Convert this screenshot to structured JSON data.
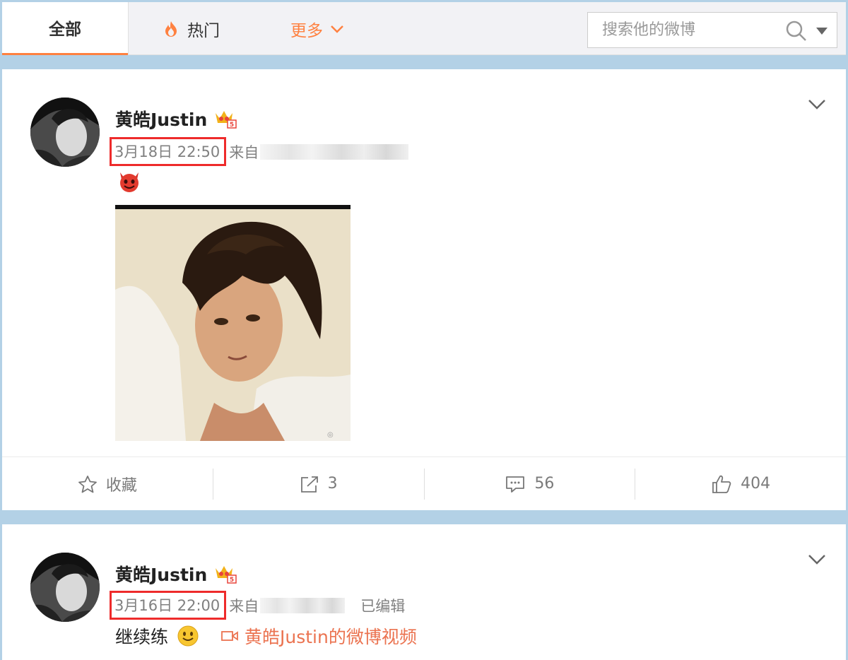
{
  "tabs": {
    "all": "全部",
    "hot": "热门",
    "more": "更多"
  },
  "search": {
    "placeholder": "搜索他的微博"
  },
  "posts": [
    {
      "username": "黄皓Justin",
      "time": "3月18日 22:50",
      "source_prefix": "来自",
      "actions": {
        "favorite": "收藏",
        "repost": "3",
        "comment": "56",
        "like": "404"
      }
    },
    {
      "username": "黄皓Justin",
      "time": "3月16日 22:00",
      "source_prefix": "来自",
      "edited": "已编辑",
      "text": "继续练",
      "video_link": "黄皓Justin的微博视频"
    }
  ],
  "colors": {
    "accent": "#ff8140",
    "highlight_box": "#ee2b2b",
    "link": "#eb7350"
  },
  "icons": [
    "fire-icon",
    "chevron-down-icon",
    "search-icon",
    "caret-down-icon",
    "crown-icon",
    "devil-emoji-icon",
    "star-icon",
    "share-icon",
    "comment-icon",
    "thumbs-up-icon",
    "smile-emoji-icon",
    "video-icon"
  ]
}
